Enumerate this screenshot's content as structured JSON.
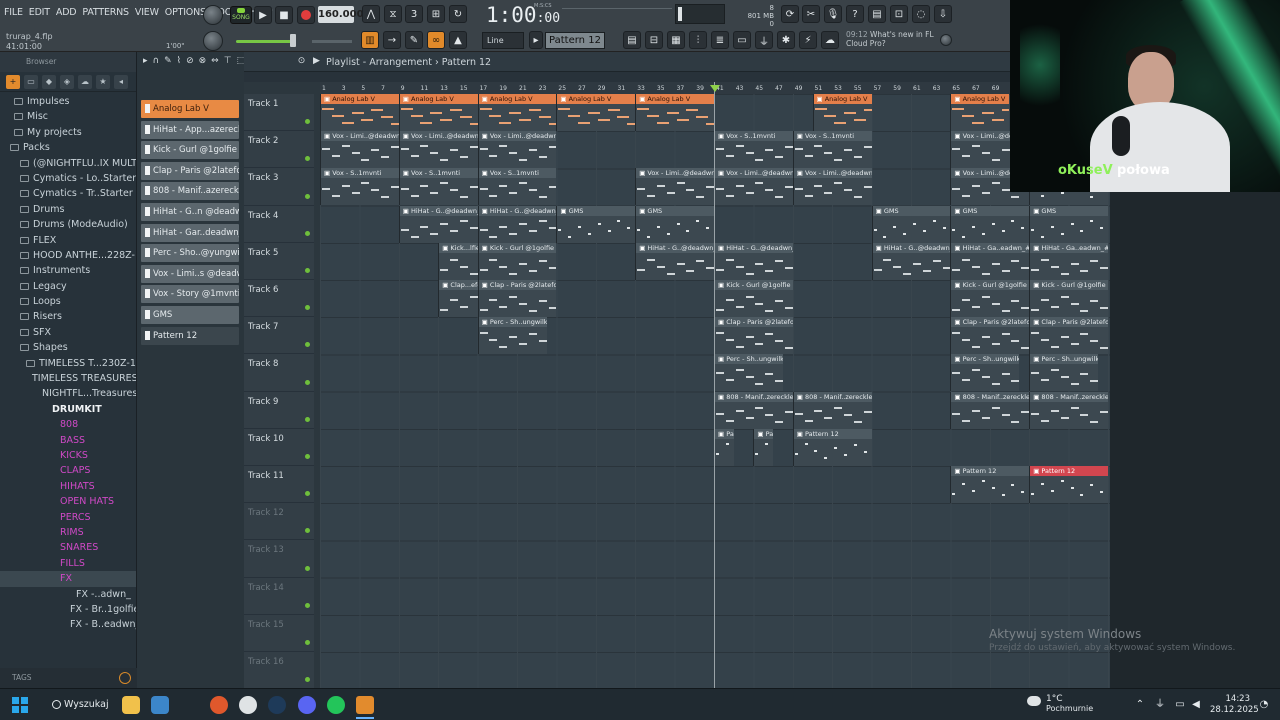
{
  "window": {
    "menu": [
      "FILE",
      "EDIT",
      "ADD",
      "PATTERNS",
      "VIEW",
      "OPTIONS",
      "TOOLS",
      "HELP"
    ],
    "project_name": "trurap_4.flp",
    "project_time": "41:01:00",
    "small_time": "1'00\"",
    "song_mode_label": "SONG",
    "tempo": "160.000",
    "time_display": "1:00",
    "time_display_small": ":00",
    "time_unit": "M:S:CS",
    "cpu_value": "8",
    "mem_value": "801 MB",
    "mem_sub": "0",
    "snap_mode": "Line",
    "pattern_selected": "Pattern 12",
    "news_time": "09:12",
    "news_text": "What's new in FL Cloud Pro?"
  },
  "browser": {
    "title": "Browser",
    "items": [
      "Impulses",
      "Misc",
      "My projects",
      "Packs",
      "(@NIGHTFLU..IX MULTI-KIT",
      "Cymatics - Lo..Starter Pack",
      "Cymatics - Tr..Starter Pack",
      "Drums",
      "Drums (ModeAudio)",
      "FLEX",
      "HOOD ANTHE...228Z-1-001",
      "Instruments",
      "Legacy",
      "Loops",
      "Risers",
      "SFX",
      "Shapes",
      "TIMELESS T...230Z-1-001",
      "TIMELESS TREASURES",
      "NIGHTFL...Treasures",
      "DRUMKIT",
      "808",
      "BASS",
      "KICKS",
      "CLAPS",
      "HIHATS",
      "OPEN HATS",
      "PERCS",
      "RIMS",
      "SNARES",
      "FILLS",
      "FX",
      "FX -..adwn_",
      "FX - Br..1golfie",
      "FX - B..eadwn_"
    ],
    "tags_label": "TAGS"
  },
  "picker": {
    "items": [
      "Analog Lab V",
      "HiHat - App...azereckless",
      "Kick - Gurl @1golfie",
      "Clap - Paris @2latefor",
      "808 - Manif..azereckless",
      "HiHat - G..n @deadwn_",
      "HiHat - Gar..deadwn_ #2",
      "Perc - Sho..@yungwilku",
      "Vox - Limi..s @deadwn_",
      "Vox - Story @1mvnti",
      "GMS",
      "Pattern 12"
    ]
  },
  "playlist": {
    "breadcrumb": [
      "Playlist",
      "Arrangement",
      "Pattern 12"
    ],
    "tracks": [
      "Track 1",
      "Track 2",
      "Track 3",
      "Track 4",
      "Track 5",
      "Track 6",
      "Track 7",
      "Track 8",
      "Track 9",
      "Track 10",
      "Track 11",
      "Track 12",
      "Track 13",
      "Track 14",
      "Track 15",
      "Track 16"
    ],
    "ruler": [
      "1",
      "3",
      "5",
      "7",
      "9",
      "11",
      "13",
      "15",
      "17",
      "19",
      "21",
      "23",
      "25",
      "27",
      "29",
      "31",
      "33",
      "35",
      "37",
      "39",
      "41",
      "43",
      "45",
      "47",
      "49",
      "51",
      "53",
      "55",
      "57",
      "59",
      "61",
      "63",
      "65",
      "67",
      "69"
    ],
    "clips": {
      "analog": "Analog Lab V",
      "vox_limi": "Vox - Limi..@deadwn_",
      "vox_limi_b": "Vox - Limi..@deadwn_",
      "vox_story": "Vox - S..1mvnti",
      "hihat_g": "HiHat - G..@deadwn_",
      "hihat_g2": "HiHat - G..@deadwn_",
      "hihat_ga": "HiHat - Ga..eadwn_#2",
      "gms": "GMS",
      "kick_lfie": "Kick...lfie",
      "kick": "Kick - Gurl @1golfie",
      "clap_efor": "Clap...efor",
      "clap": "Clap - Paris @2latefor",
      "perc": "Perc - Sh..ungwilku",
      "bass808": "808 - Manif..zereckless",
      "pattern12": "Pattern 12"
    }
  },
  "overlay": {
    "streamer_name": "oKuseV",
    "streamer_tag": "połowa",
    "activation_title": "Aktywuj system Windows",
    "activation_sub": "Przejdź do ustawień, aby aktywować system Windows."
  },
  "taskbar": {
    "search_label": "Wyszukaj",
    "weather_temp": "1°C",
    "weather_desc": "Pochmurnie",
    "time": "14:23",
    "date": "28.12.2025"
  }
}
